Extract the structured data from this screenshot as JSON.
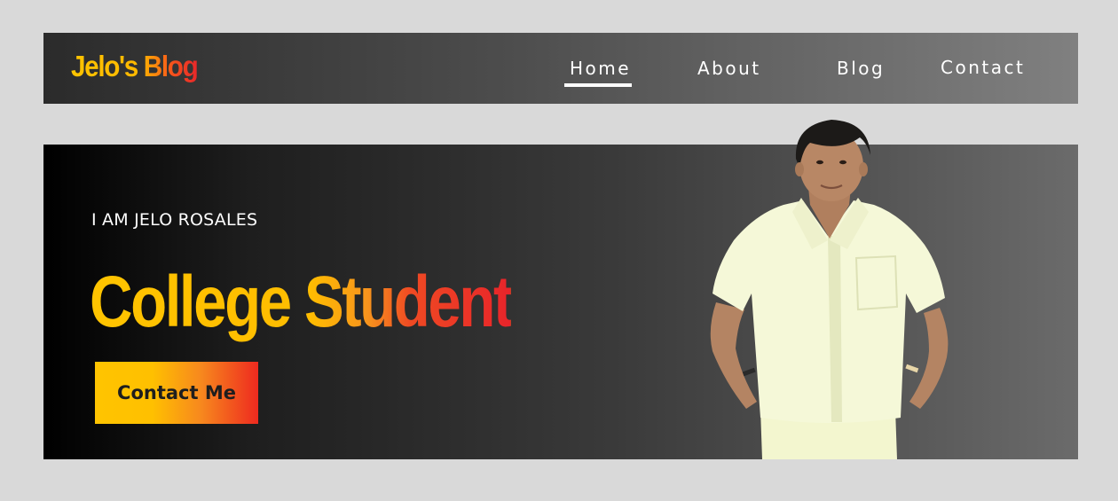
{
  "header": {
    "logo_text": "Jelo's Blog",
    "nav": [
      {
        "label": "Home",
        "active": true
      },
      {
        "label": "About",
        "active": false
      },
      {
        "label": "Blog",
        "active": false
      },
      {
        "label": "Contact",
        "active": false
      }
    ]
  },
  "hero": {
    "intro": "I AM JELO ROSALES",
    "headline": "College Student",
    "cta_label": "Contact Me"
  },
  "colors": {
    "page_bg": "#d9d9d9",
    "accent_yellow": "#ffc400",
    "accent_red": "#e8242a",
    "nav_text": "#ffffff",
    "hero_dark": "#000000"
  },
  "icons": {
    "portrait": "person-photo"
  }
}
